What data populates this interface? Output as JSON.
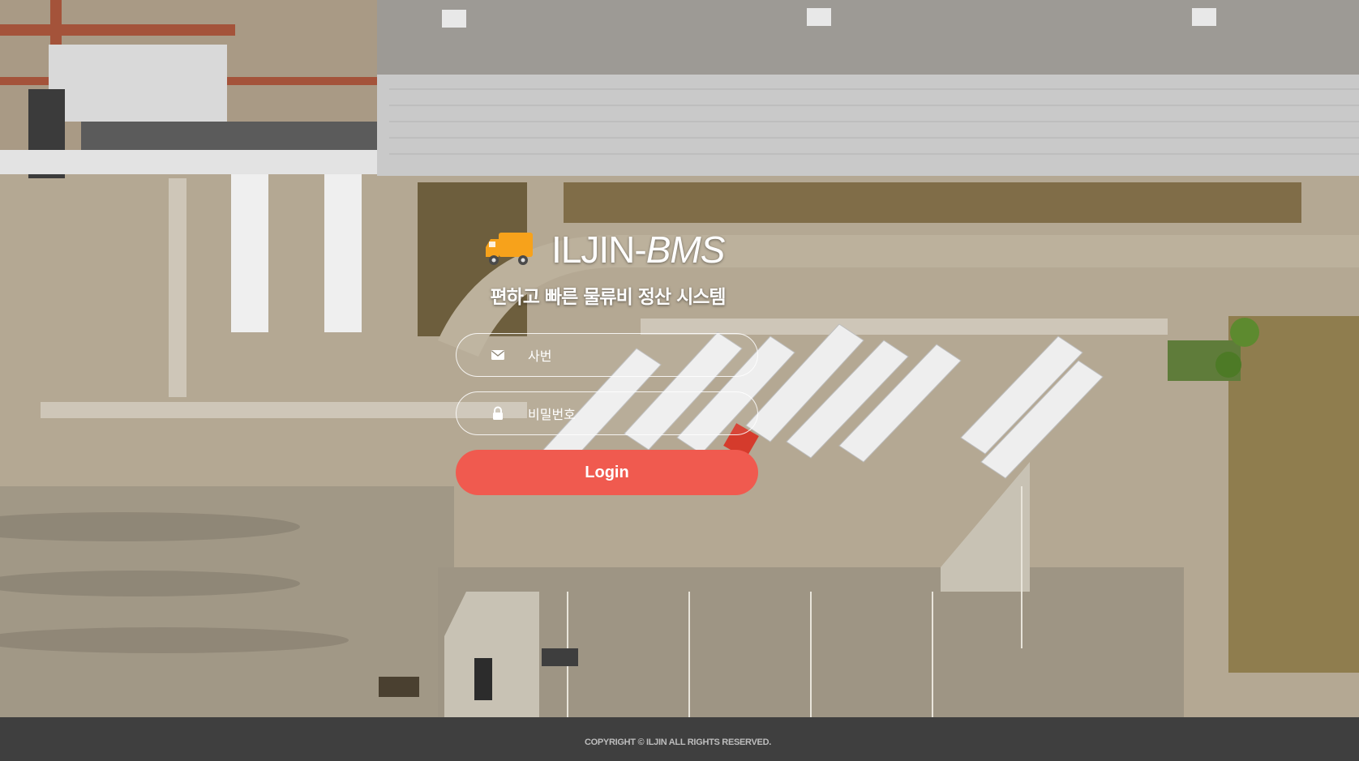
{
  "brand": {
    "name_plain": "ILJIN-",
    "name_italic": "BMS",
    "tagline": "편하고 빠른 물류비 정산 시스템",
    "icon": "truck-icon",
    "icon_color": "#f7a21b"
  },
  "login": {
    "employee_id": {
      "placeholder": "사번",
      "value": "",
      "icon": "envelope-icon"
    },
    "password": {
      "placeholder": "비밀번호",
      "value": "",
      "icon": "lock-icon"
    },
    "submit_label": "Login",
    "button_color": "#f05a4f"
  },
  "footer": {
    "copyright": "COPYRIGHT © ILJIN ALL RIGHTS RESERVED."
  }
}
